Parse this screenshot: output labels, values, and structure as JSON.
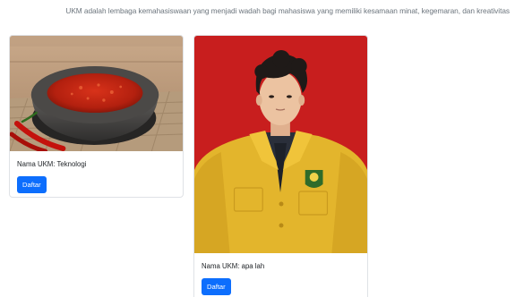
{
  "intro_text": "UKM adalah lembaga kemahasiswaan yang menjadi wadah bagi mahasiswa yang memiliki kesamaan minat, kegemaran, dan kreativitas",
  "cards": [
    {
      "image": "sambal-in-stone-mortar-photo",
      "title": "Nama UKM: Teknologi",
      "button_label": "Daftar"
    },
    {
      "image": "student-portrait-yellow-jacket-photo",
      "title": "Nama UKM: apa lah",
      "button_label": "Daftar"
    }
  ],
  "colors": {
    "button": "#0d6efd",
    "portrait_background": "#c81e1e",
    "jacket": "#e3b52c"
  }
}
